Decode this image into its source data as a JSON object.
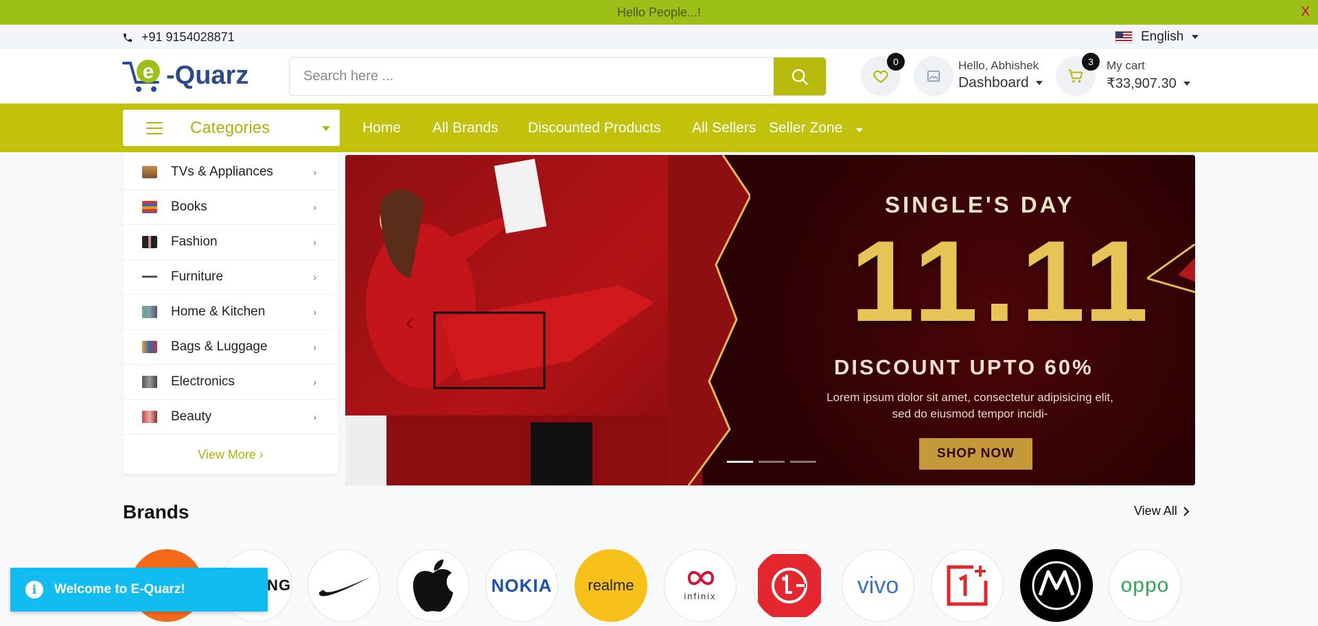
{
  "announcement": {
    "text": "Hello People...!",
    "close": "X"
  },
  "topbar": {
    "phone": "+91 9154028871",
    "language": "English"
  },
  "header": {
    "logo_text": "-Quarz",
    "logo_letter": "e",
    "search_placeholder": "Search here ...",
    "wishlist_count": "0",
    "account_greeting": "Hello, Abhishek",
    "account_label": "Dashboard",
    "cart_count": "3",
    "cart_label": "My cart",
    "cart_total": "₹33,907.30"
  },
  "nav": {
    "categories_label": "Categories",
    "items": [
      "Home",
      "All Brands",
      "Discounted Products",
      "All Sellers",
      "Seller Zone"
    ]
  },
  "categories": {
    "items": [
      {
        "label": "TVs & Appliances",
        "arrow": "›"
      },
      {
        "label": "Books",
        "arrow": "›"
      },
      {
        "label": "Fashion",
        "arrow": "›"
      },
      {
        "label": "Furniture",
        "arrow": "›"
      },
      {
        "label": "Home & Kitchen",
        "arrow": "›"
      },
      {
        "label": "Bags & Luggage",
        "arrow": "›"
      },
      {
        "label": "Electronics",
        "arrow": "›"
      },
      {
        "label": "Beauty",
        "arrow": "›"
      }
    ],
    "view_more": "View More ›"
  },
  "banner": {
    "title": "SINGLE'S DAY",
    "big": "11.11",
    "discount": "DISCOUNT UPTO 60%",
    "lorem": "Lorem ipsum dolor sit amet, consectetur adipisicing elit, sed do eiusmod tempor incidi-",
    "cta": "SHOP NOW",
    "prev": "‹",
    "next": "›"
  },
  "brands": {
    "title": "Brands",
    "view_all": "View All",
    "items": [
      "",
      "ING",
      "",
      "",
      "NOKIA",
      "realme",
      "infinix",
      "",
      "vivo",
      "",
      "",
      "oppo"
    ]
  },
  "toast": {
    "icon": "i",
    "text": "Welcome to E-Quarz!"
  },
  "colors": {
    "primary": "#c2c20d",
    "announce": "#9cc017",
    "accent": "#b8ba0b",
    "toast": "#11bdf0"
  }
}
